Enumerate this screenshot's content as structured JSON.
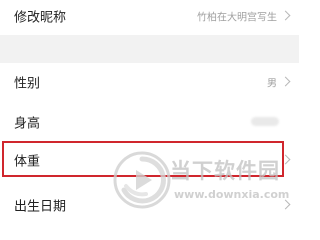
{
  "profile": {
    "items": [
      {
        "label": "修改昵称",
        "value": "竹柏在大明宫写生"
      },
      {
        "label": "性别",
        "value": "男"
      },
      {
        "label": "身高",
        "value": ""
      },
      {
        "label": "体重",
        "value": ""
      },
      {
        "label": "出生日期",
        "value": ""
      }
    ]
  },
  "watermark": {
    "text": "当下软件园",
    "url": "www.downxia.com"
  },
  "colors": {
    "highlight": "#d0262d",
    "divider_gap": "#f2f2f2",
    "value_text": "#a0a0a0"
  },
  "icons": {
    "row_arrow": "chevron-right-icon",
    "watermark_logo": "downxia-logo"
  }
}
